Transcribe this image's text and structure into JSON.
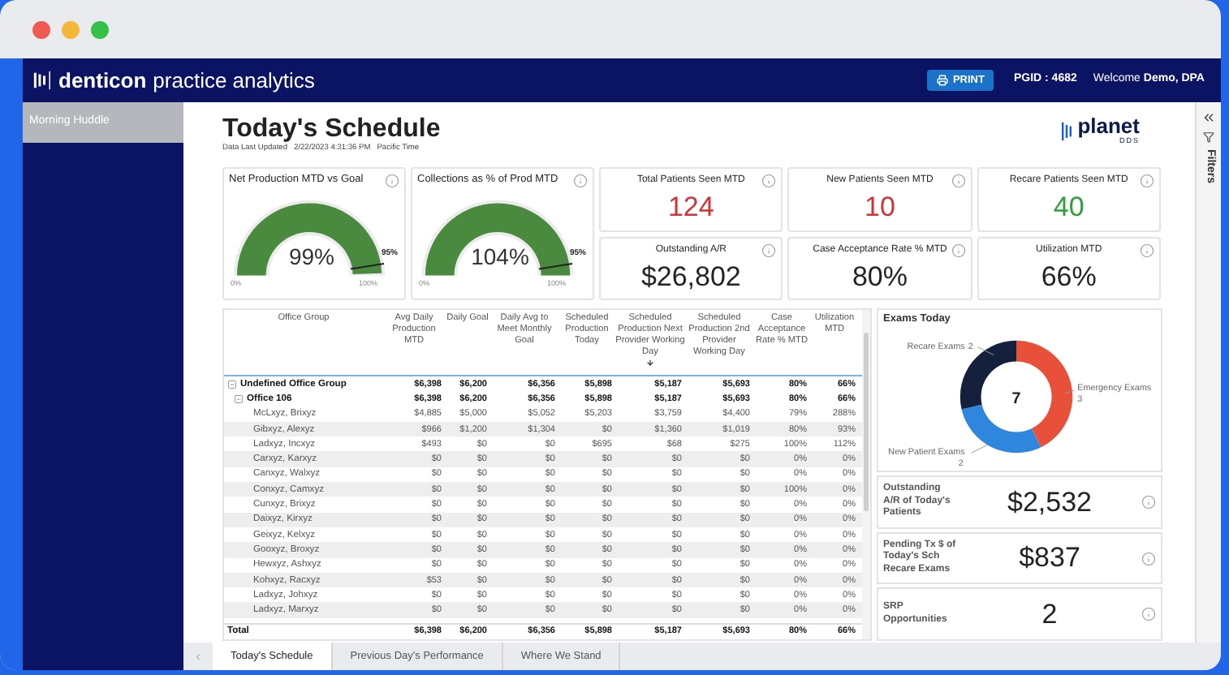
{
  "header": {
    "brand": "denticon",
    "product": "practice analytics",
    "print_button": "PRINT",
    "pgid": "PGID : 4682",
    "welcome": "Welcome **Demo, DPA**"
  },
  "sidebar": {
    "items": [
      {
        "label": "Morning Huddle",
        "selected": true
      }
    ]
  },
  "report": {
    "title": "Today's Schedule",
    "updated_label": "Data Last Updated",
    "updated_value": "2/22/2023 4:31:36 PM",
    "timezone": "Pacific Time",
    "logo_name": "planet",
    "logo_sub": "DDS"
  },
  "gauges": [
    {
      "title": "Net Production MTD vs Goal",
      "value": "99%",
      "level": 0.99,
      "target": "95%",
      "min": "0%",
      "max": "100%"
    },
    {
      "title": "Collections as % of Prod MTD",
      "value": "104%",
      "level": 1,
      "target": "95%",
      "min": "0%",
      "max": "100%"
    }
  ],
  "kpis": [
    {
      "title": "Total Patients Seen MTD",
      "value": "124",
      "color": "#d13438"
    },
    {
      "title": "New Patients Seen MTD",
      "value": "10",
      "color": "#d13438"
    },
    {
      "title": "Recare Patients Seen MTD",
      "value": "40",
      "color": "#2e9e3e"
    },
    {
      "title": "Outstanding A/R",
      "value": "$26,802",
      "color": "#252423"
    },
    {
      "title": "Case Acceptance Rate % MTD",
      "value": "80%",
      "color": "#252423"
    },
    {
      "title": "Utilization MTD",
      "value": "66%",
      "color": "#252423"
    }
  ],
  "table": {
    "columns": [
      {
        "label": "Office Group",
        "sorted": false
      },
      {
        "label": "Avg Daily Production MTD",
        "sorted": false
      },
      {
        "label": "Daily Goal",
        "sorted": false
      },
      {
        "label": "Daily Avg to Meet Monthly Goal",
        "sorted": false
      },
      {
        "label": "Scheduled Production Today",
        "sorted": false
      },
      {
        "label": "Scheduled Production Next Provider Working Day",
        "sorted": true
      },
      {
        "label": "Scheduled Production 2nd Provider Working Day",
        "sorted": false
      },
      {
        "label": "Case Acceptance Rate % MTD",
        "sorted": false
      },
      {
        "label": "Utilization MTD",
        "sorted": false
      }
    ],
    "rows": [
      {
        "name": "Undefined Office Group",
        "expanded": true,
        "values": [
          "$6,398",
          "$6,200",
          "$6,356",
          "$5,898",
          "$5,187",
          "$5,693",
          "80%",
          "66%"
        ],
        "children": [
          {
            "name": "Office 106",
            "expanded": true,
            "values": [
              "$6,398",
              "$6,200",
              "$6,356",
              "$5,898",
              "$5,187",
              "$5,693",
              "80%",
              "66%"
            ],
            "children": [
              {
                "name": "McLxyz, Brixyz",
                "values": [
                  "$4,885",
                  "$5,000",
                  "$5,052",
                  "$5,203",
                  "$3,759",
                  "$4,400",
                  "79%",
                  "288%"
                ]
              },
              {
                "name": "Gibxyz, Alexyz",
                "values": [
                  "$966",
                  "$1,200",
                  "$1,304",
                  "$0",
                  "$1,360",
                  "$1,019",
                  "80%",
                  "93%"
                ]
              },
              {
                "name": "Ladxyz, Incxyz",
                "values": [
                  "$493",
                  "$0",
                  "$0",
                  "$695",
                  "$68",
                  "$275",
                  "100%",
                  "112%"
                ]
              },
              {
                "name": "Carxyz, Karxyz",
                "values": [
                  "$0",
                  "$0",
                  "$0",
                  "$0",
                  "$0",
                  "$0",
                  "0%",
                  "0%"
                ]
              },
              {
                "name": "Canxyz, Walxyz",
                "values": [
                  "$0",
                  "$0",
                  "$0",
                  "$0",
                  "$0",
                  "$0",
                  "0%",
                  "0%"
                ]
              },
              {
                "name": "Conxyz, Camxyz",
                "values": [
                  "$0",
                  "$0",
                  "$0",
                  "$0",
                  "$0",
                  "$0",
                  "100%",
                  "0%"
                ]
              },
              {
                "name": "Cunxyz, Brixyz",
                "values": [
                  "$0",
                  "$0",
                  "$0",
                  "$0",
                  "$0",
                  "$0",
                  "0%",
                  "0%"
                ]
              },
              {
                "name": "Daixyz, Kirxyz",
                "values": [
                  "$0",
                  "$0",
                  "$0",
                  "$0",
                  "$0",
                  "$0",
                  "0%",
                  "0%"
                ]
              },
              {
                "name": "Geixyz, Kelxyz",
                "values": [
                  "$0",
                  "$0",
                  "$0",
                  "$0",
                  "$0",
                  "$0",
                  "0%",
                  "0%"
                ]
              },
              {
                "name": "Gooxyz, Broxyz",
                "values": [
                  "$0",
                  "$0",
                  "$0",
                  "$0",
                  "$0",
                  "$0",
                  "0%",
                  "0%"
                ]
              },
              {
                "name": "Hewxyz, Ashxyz",
                "values": [
                  "$0",
                  "$0",
                  "$0",
                  "$0",
                  "$0",
                  "$0",
                  "0%",
                  "0%"
                ]
              },
              {
                "name": "Kohxyz, Racxyz",
                "values": [
                  "$53",
                  "$0",
                  "$0",
                  "$0",
                  "$0",
                  "$0",
                  "0%",
                  "0%"
                ]
              },
              {
                "name": "Ladxyz, Johxyz",
                "values": [
                  "$0",
                  "$0",
                  "$0",
                  "$0",
                  "$0",
                  "$0",
                  "0%",
                  "0%"
                ]
              },
              {
                "name": "Ladxyz, Marxyz",
                "values": [
                  "$0",
                  "$0",
                  "$0",
                  "$0",
                  "$0",
                  "$0",
                  "0%",
                  "0%"
                ]
              }
            ]
          }
        ]
      }
    ],
    "total": {
      "label": "Total",
      "values": [
        "$6,398",
        "$6,200",
        "$6,356",
        "$5,898",
        "$5,187",
        "$5,693",
        "80%",
        "66%"
      ]
    }
  },
  "exams": {
    "center_label": "7",
    "chart_data": {
      "type": "donut",
      "title": "Exams Today",
      "categories": [
        "Emergency Exams",
        "New Patient Exams",
        "Recare Exams"
      ],
      "values": [
        3,
        2,
        2
      ],
      "colors": [
        "#e8503a",
        "#2f86dd",
        "#15203d"
      ],
      "data_labels": true
    }
  },
  "side_cards": [
    {
      "title": "Outstanding A/R of Today's Patients",
      "value": "$2,532"
    },
    {
      "title": "Pending Tx $ of Today's Sch Recare Exams",
      "value": "$837"
    },
    {
      "title": "SRP Opportunities",
      "value": "2"
    }
  ],
  "filters": {
    "label": "Filters"
  },
  "tabs": [
    {
      "label": "Today's Schedule",
      "selected": true
    },
    {
      "label": "Previous Day's Performance",
      "selected": false
    },
    {
      "label": "Where We Stand",
      "selected": false
    }
  ]
}
